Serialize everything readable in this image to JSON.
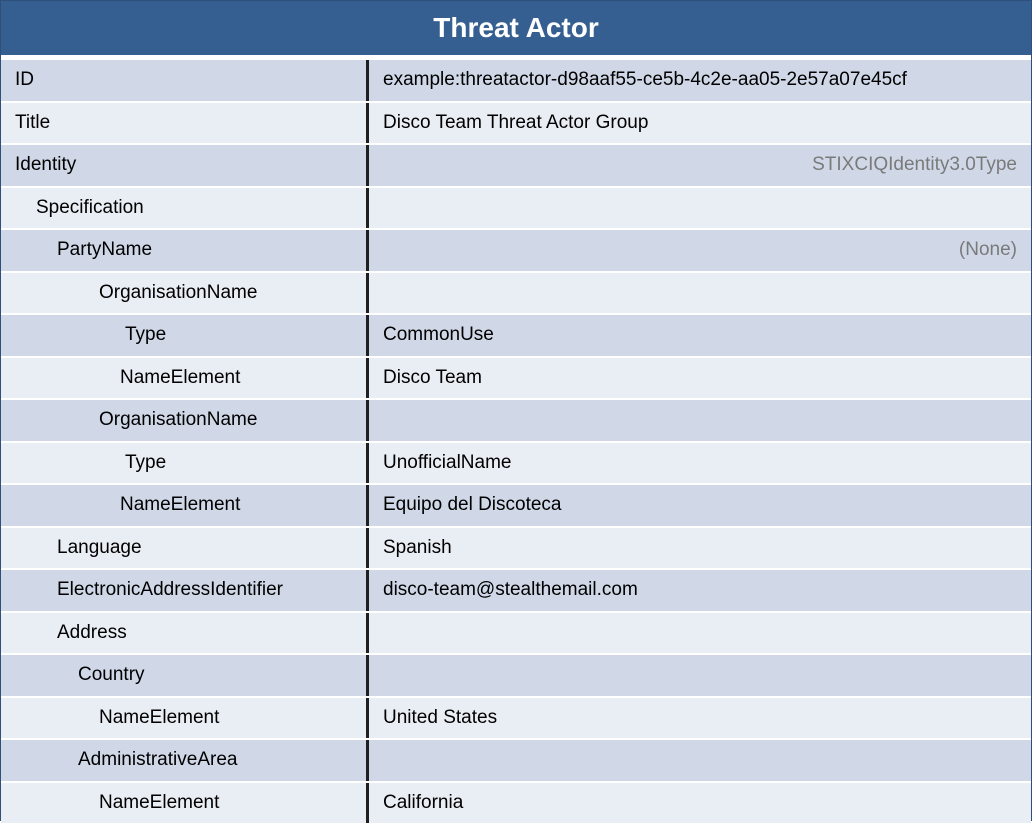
{
  "title": "Threat Actor",
  "rows": [
    {
      "key": "ID",
      "value": "example:threatactor-d98aaf55-ce5b-4c2e-aa05-2e57a07e45cf",
      "indent": 0,
      "right": false
    },
    {
      "key": "Title",
      "value": "Disco Team Threat Actor Group",
      "indent": 0,
      "right": false
    },
    {
      "key": "Identity",
      "value": "STIXCIQIdentity3.0Type",
      "indent": 0,
      "right": true
    },
    {
      "key": "Specification",
      "value": "",
      "indent": 1,
      "right": false
    },
    {
      "key": "PartyName",
      "value": "(None)",
      "indent": 2,
      "right": true
    },
    {
      "key": "OrganisationName",
      "value": "",
      "indent": 3,
      "right": false
    },
    {
      "key": "Type",
      "value": "CommonUse",
      "indent": 4,
      "right": false
    },
    {
      "key": "NameElement",
      "value": "Disco Team",
      "indent": 3.5,
      "right": false
    },
    {
      "key": "OrganisationName",
      "value": "",
      "indent": 3,
      "right": false
    },
    {
      "key": "Type",
      "value": "UnofficialName",
      "indent": 4,
      "right": false
    },
    {
      "key": "NameElement",
      "value": "Equipo del Discoteca",
      "indent": 3.5,
      "right": false
    },
    {
      "key": "Language",
      "value": "Spanish",
      "indent": 2,
      "right": false
    },
    {
      "key": "ElectronicAddressIdentifier",
      "value": "disco-team@stealthemail.com",
      "indent": 2,
      "right": false
    },
    {
      "key": "Address",
      "value": "",
      "indent": 2,
      "right": false
    },
    {
      "key": "Country",
      "value": "",
      "indent": 2.5,
      "right": false
    },
    {
      "key": "NameElement",
      "value": "United States",
      "indent": 3,
      "right": false
    },
    {
      "key": "AdministrativeArea",
      "value": "",
      "indent": 2.5,
      "right": false
    },
    {
      "key": "NameElement",
      "value": "California",
      "indent": 3,
      "right": false
    }
  ],
  "colors": {
    "header_bg": "#365f91",
    "row_dark": "#d0d8e8",
    "row_light": "#e9edf4",
    "muted_text": "#7a7a7a"
  }
}
